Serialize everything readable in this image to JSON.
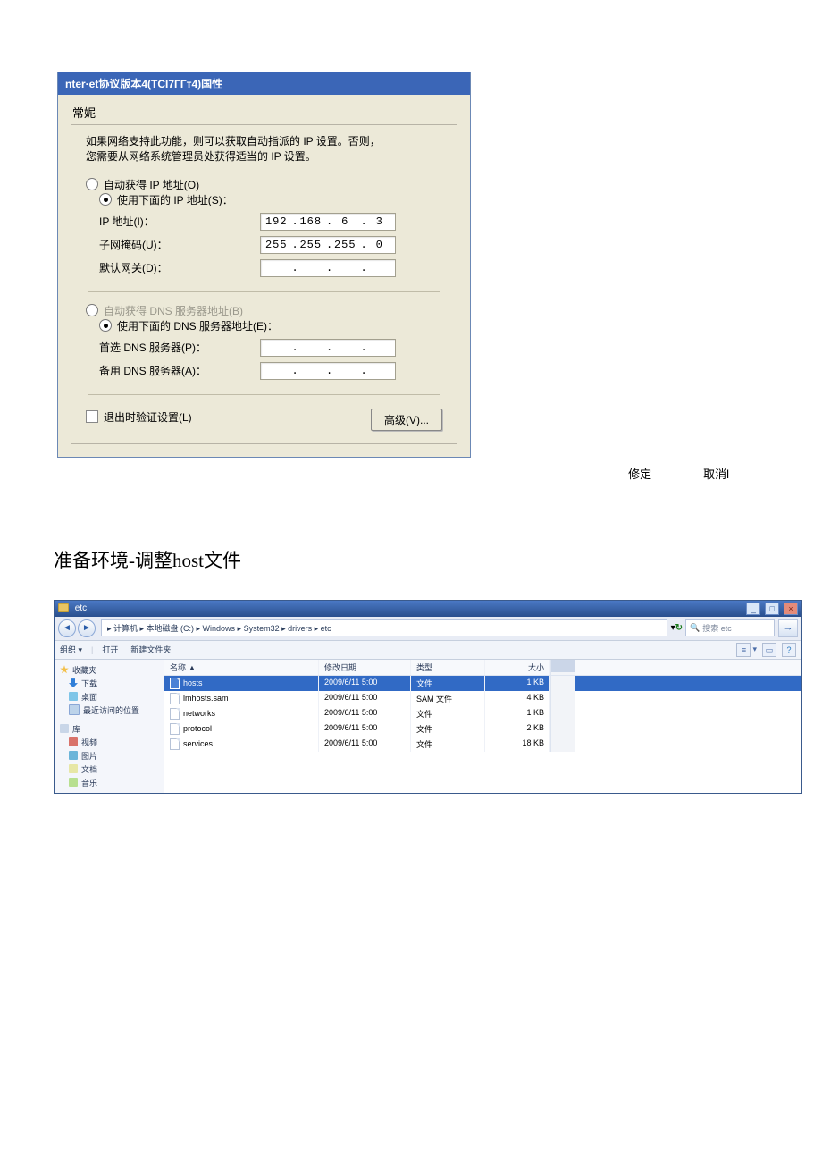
{
  "dialog": {
    "title": "nter·et协议版本4(TCI7ГГт4)国性",
    "tab": "常妮",
    "desc1": "如果网络支持此功能，则可以获取自动指派的 IP 设置。否则，",
    "desc2": "您需要从网络系统管理员处获得适当的 IP 设置。",
    "radio_auto_ip": "自动获得 IP 地址(O)",
    "radio_manual_ip": "使用下面的 IP 地址(S)：",
    "label_ip": "IP 地址(I)：",
    "label_mask": "子网掩码(U)：",
    "label_gateway": "默认网关(D)：",
    "ip": [
      "192",
      "168",
      "6",
      "3"
    ],
    "mask": [
      "255",
      "255",
      "255",
      "0"
    ],
    "gateway": [
      "",
      "",
      "",
      ""
    ],
    "radio_auto_dns": "自动获得 DNS 服务器地址(B)",
    "radio_manual_dns": "使用下面的 DNS 服务器地址(E)：",
    "label_dns1": "首选 DNS 服务器(P)：",
    "label_dns2": "备用 DNS 服务器(A)：",
    "dns1": [
      "",
      "",
      "",
      ""
    ],
    "dns2": [
      "",
      "",
      "",
      ""
    ],
    "chk_validate": "退出时验证设置(L)",
    "btn_advanced": "高级(V)...",
    "btn_ok": "修定",
    "btn_cancel": "取消l"
  },
  "section_heading": "准备环境-调整host文件",
  "explorer": {
    "win_title": "etc",
    "breadcrumb": "▸ 计算机 ▸ 本地磁盘 (C:) ▸ Windows ▸ System32 ▸ drivers ▸ etc",
    "search_placeholder": "搜索 etc",
    "toolbar": {
      "organize": "组织 ▾",
      "open": "打开",
      "new_folder": "新建文件夹"
    },
    "columns": {
      "name": "名称 ▲",
      "date": "修改日期",
      "type": "类型",
      "size": "大小"
    },
    "sidebar": {
      "fav_header": "收藏夹",
      "fav": [
        "下载",
        "桌面",
        "最近访问的位置"
      ],
      "lib_header": "库",
      "lib": [
        "视频",
        "图片",
        "文档",
        "音乐"
      ]
    },
    "files": [
      {
        "name": "hosts",
        "date": "2009/6/11 5:00",
        "type": "文件",
        "size": "1 KB",
        "selected": true
      },
      {
        "name": "lmhosts.sam",
        "date": "2009/6/11 5:00",
        "type": "SAM 文件",
        "size": "4 KB",
        "selected": false
      },
      {
        "name": "networks",
        "date": "2009/6/11 5:00",
        "type": "文件",
        "size": "1 KB",
        "selected": false
      },
      {
        "name": "protocol",
        "date": "2009/6/11 5:00",
        "type": "文件",
        "size": "2 KB",
        "selected": false
      },
      {
        "name": "services",
        "date": "2009/6/11 5:00",
        "type": "文件",
        "size": "18 KB",
        "selected": false
      }
    ]
  }
}
